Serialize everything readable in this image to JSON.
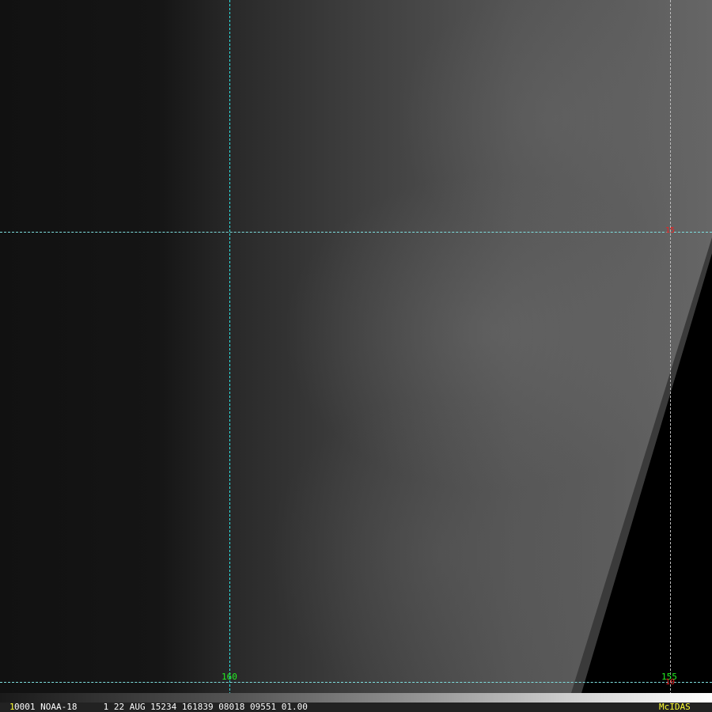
{
  "overlay": {
    "lon_labels": [
      {
        "text": "160",
        "color": "#22ee22"
      },
      {
        "text": "155",
        "color": "#22ee22"
      }
    ],
    "lat_labels": [
      {
        "text": "15",
        "color": "#ee2222"
      },
      {
        "text": "10",
        "color": "#ee2222"
      }
    ]
  },
  "infobar": {
    "frame": "1",
    "text": "0001 NOAA-18     1 22 AUG 15234 161839 08018 09551 01.00",
    "brand": "McIDAS",
    "colors": {
      "frame": "#ffff33",
      "brand": "#ffff33",
      "text": "#ffffff"
    }
  }
}
